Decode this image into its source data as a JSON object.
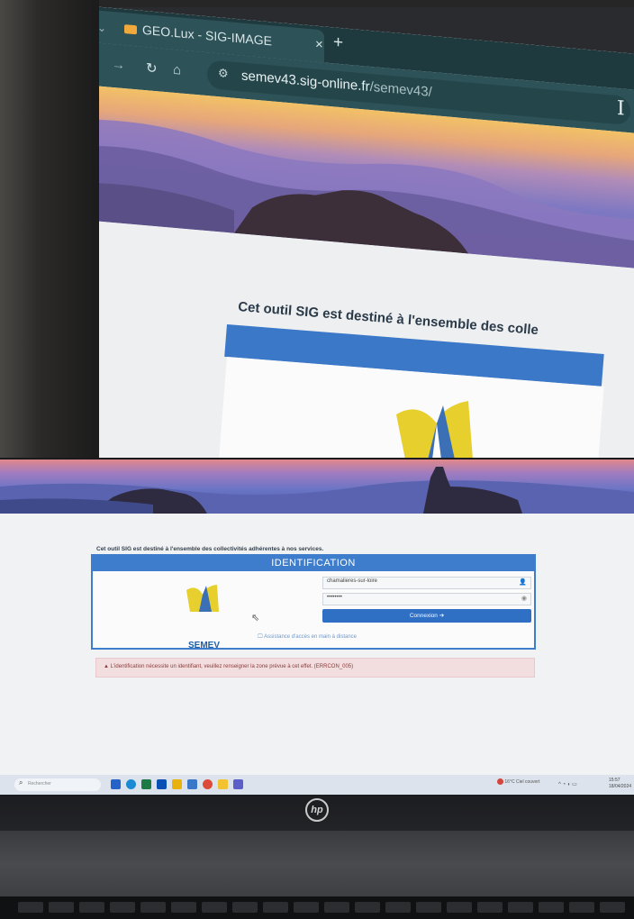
{
  "browser": {
    "tab_title": "GEO.Lux - SIG-IMAGE",
    "tab_close": "×",
    "new_tab": "+",
    "url_host": "semev43.sig-online.fr",
    "url_path": "/semev43/"
  },
  "page": {
    "intro_partial": "Cet outil SIG est destiné à l'ensemble des colle",
    "intro": "Cet outil SIG est destiné à l'ensemble des collectivités adhérentes à nos services.",
    "panel_title": "IDENTIFICATION",
    "logo_text": "SEMEV",
    "username_value": "chamalieres-sur-loire",
    "password_value": "••••••••",
    "connexion_label": "Connexion ➔",
    "remote_help_link": "Assistance d'accès en main à distance",
    "error_message": "L'identification nécessite un identifiant, veuillez renseigner la zone prévue à cet effet. (ERRCON_005)"
  },
  "taskbar": {
    "search_placeholder": "Rechercher",
    "weather_temp": "16°C",
    "weather_desc": "Ciel couvert",
    "clock_time": "15:57",
    "clock_date": "18/04/2024"
  },
  "laptop": {
    "brand": "hp"
  },
  "colors": {
    "accent": "#3e7dcc",
    "error_bg": "#f2dede",
    "browser_toolbar": "#2d5258"
  }
}
